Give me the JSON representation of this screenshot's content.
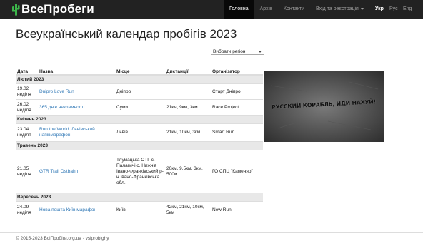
{
  "brand": {
    "name": "ВсеПробеги",
    "logo_icon": "cactus-icon",
    "logo_color": "#3cb54a"
  },
  "nav": {
    "items": [
      {
        "label": "Головна",
        "active": true
      },
      {
        "label": "Архів",
        "active": false
      },
      {
        "label": "Контакти",
        "active": false
      },
      {
        "label": "Вхід та реєстрація",
        "active": false,
        "dropdown": true
      }
    ],
    "languages": [
      "Укр",
      "Рус",
      "Eng"
    ],
    "active_language": "Укр"
  },
  "page": {
    "title": "Всеукраїнський календар пробігів 2023"
  },
  "region_filter": {
    "selected": "Вибрати регіон"
  },
  "table": {
    "headers": [
      "Дата",
      "Назва",
      "Місце",
      "Дистанції",
      "Організатор"
    ],
    "groups": [
      {
        "month": "Лютий 2023",
        "rows": [
          {
            "date": "19.02",
            "weekday": "неділя",
            "name": "Dnipro Love Run",
            "place": "Дніпро",
            "distances": "",
            "organizer": "Старт Дніпро"
          },
          {
            "date": "26.02",
            "weekday": "неділя",
            "name": "365 днів незламності",
            "place": "Суми",
            "distances": "21км, 9км, 3км",
            "organizer": "Race Project"
          }
        ]
      },
      {
        "month": "Квітень 2023",
        "rows": [
          {
            "date": "23.04",
            "weekday": "неділя",
            "name": "Run the World. Львівський напівмарафон",
            "place": "Львів",
            "distances": "21км, 10км, 3км",
            "organizer": "Smart Run"
          }
        ]
      },
      {
        "month": "Травень 2023",
        "rows": [
          {
            "date": "21.05",
            "weekday": "неділя",
            "name": "GTR Trail Ostbahn",
            "place": "Тлумацька ОТГ с. Палагичі с. Нижнів Івано-Франківський р-н Івано-Франківська обл.",
            "distances": "20км, 9,5км, 3км, 500м",
            "organizer": "ГО СПЦ \"Каменяр\""
          }
        ]
      },
      {
        "month": "Вересень 2023",
        "rows": [
          {
            "date": "24.09",
            "weekday": "неділя",
            "name": "Нова пошта Київ марафон",
            "place": "Київ",
            "distances": "42км, 21км, 10км, 5км",
            "organizer": "New Run"
          }
        ]
      }
    ]
  },
  "banner": {
    "text": "РУССКИЙ КОРАБЛЬ, ИДИ НАХУЙ!"
  },
  "footer": {
    "text": "© 2015-2023 ВсіПробіги.org.ua  ·  vsiprobighy"
  }
}
